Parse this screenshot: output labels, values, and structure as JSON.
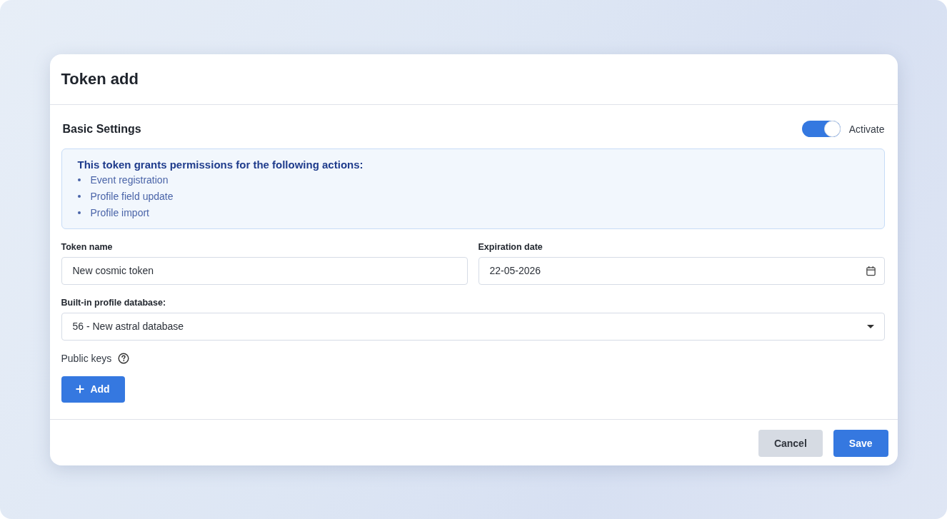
{
  "dialog": {
    "title": "Token add"
  },
  "section": {
    "title": "Basic Settings",
    "activate": {
      "label": "Activate",
      "on": true
    }
  },
  "info": {
    "title": "This token grants permissions for the following actions:",
    "items": [
      "Event registration",
      "Profile field update",
      "Profile import"
    ]
  },
  "fields": [
    {
      "kind": "text",
      "label": "Token name",
      "value": "New cosmic token"
    },
    {
      "kind": "date",
      "label": "Expiration date",
      "value": "22-05-2026"
    },
    {
      "kind": "select",
      "label": "Built-in profile database:",
      "value": "56 - New astral database"
    }
  ],
  "public_keys": {
    "label": "Public keys",
    "add_button": "Add"
  },
  "footer": {
    "buttons": [
      {
        "label": "Cancel",
        "kind": "secondary"
      },
      {
        "label": "Save",
        "kind": "primary"
      }
    ]
  }
}
